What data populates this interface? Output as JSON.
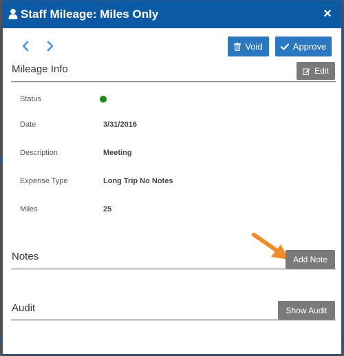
{
  "dialog": {
    "title": "Staff Mileage: Miles Only",
    "close_label": "×"
  },
  "toolbar": {
    "void_label": "Void",
    "approve_label": "Approve"
  },
  "mileage_info": {
    "title": "Mileage Info",
    "edit_label": "Edit",
    "fields": [
      {
        "label": "Status",
        "value": "",
        "status_color": "#1a8a1a"
      },
      {
        "label": "Date",
        "value": "3/31/2016"
      },
      {
        "label": "Description",
        "value": "Meeting"
      },
      {
        "label": "Expense Type",
        "value": "Long Trip No Notes"
      },
      {
        "label": "Miles",
        "value": "25"
      }
    ]
  },
  "notes": {
    "title": "Notes",
    "add_note_label": "Add Note"
  },
  "audit": {
    "title": "Audit",
    "show_audit_label": "Show Audit"
  },
  "colors": {
    "header_bg": "#0c5aa4",
    "primary_button": "#2b78c2",
    "secondary_button": "#7a7a7a",
    "annotation_arrow": "#f28c28"
  },
  "icons": {
    "header": "user-icon",
    "prev": "chevron-left-icon",
    "next": "chevron-right-icon",
    "void": "trash-icon",
    "approve": "checkmark-icon",
    "edit": "edit-icon",
    "annotation": "arrow-pointer-icon"
  }
}
